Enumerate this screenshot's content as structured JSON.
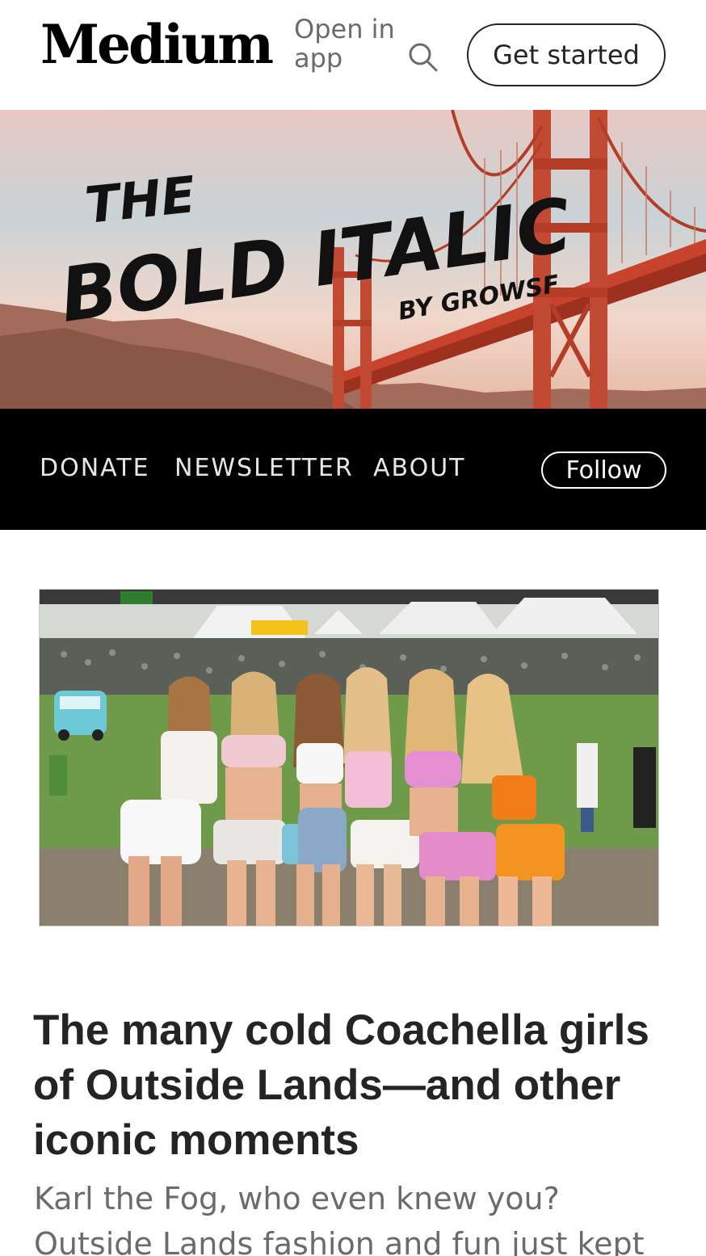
{
  "header": {
    "logo": "Medium",
    "open_in_app": "Open in app",
    "get_started": "Get started",
    "search_icon": "search-icon"
  },
  "publication": {
    "banner_line1": "THE",
    "banner_line2": "BOLD ITALIC",
    "banner_byline": "BY GROWSF",
    "nav": [
      "DONATE",
      "NEWSLETTER",
      "ABOUT"
    ],
    "follow": "Follow"
  },
  "article": {
    "title": "The many cold Coachella girls of Outside Lands—and other iconic moments",
    "subtitle": "Karl the Fog, who even knew you? Outside Lands fashion and fun just kept"
  },
  "colors": {
    "nav_bg": "#000000",
    "text": "#242424",
    "muted": "#6b6b6b",
    "bridge": "#c8432b"
  }
}
